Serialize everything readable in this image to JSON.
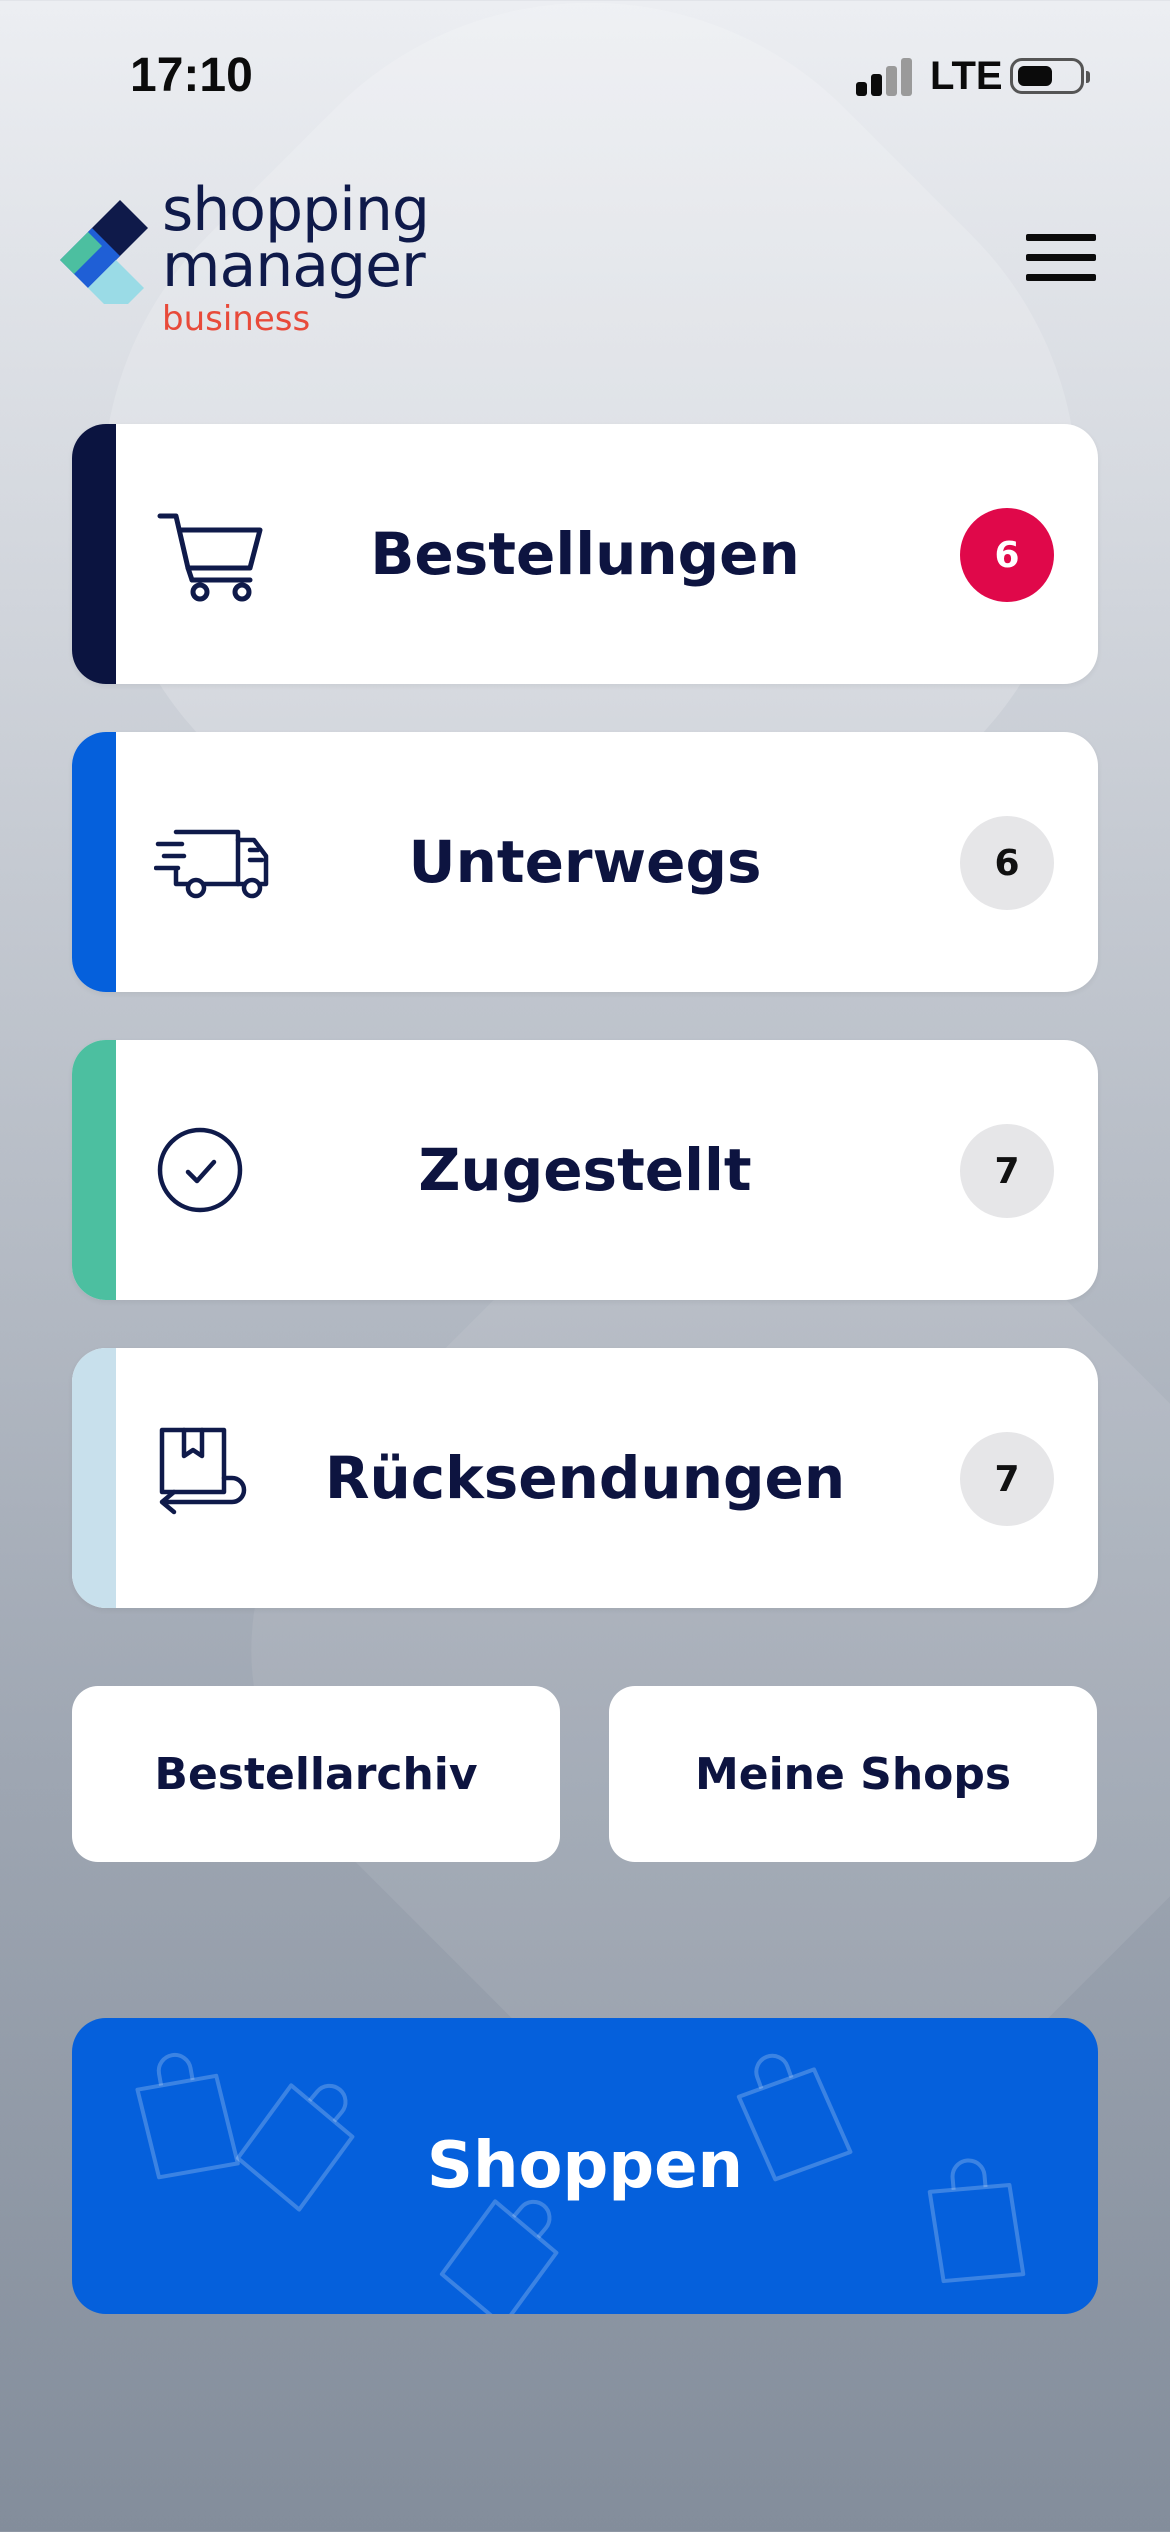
{
  "status_bar": {
    "time": "17:10",
    "network": "LTE",
    "signal_bars_active": 2,
    "signal_bars_total": 4
  },
  "header": {
    "logo_line1": "shopping",
    "logo_line2": "manager",
    "logo_sub": "business",
    "menu_icon": "hamburger-menu-icon"
  },
  "colors": {
    "navy": "#0d1440",
    "brand_blue": "#0560dc",
    "teal": "#4cbfa0",
    "light_blue": "#c8e0ec",
    "badge_red": "#e0084a",
    "logo_red": "#e84a3a"
  },
  "cards": [
    {
      "label": "Bestellungen",
      "count": "6",
      "icon": "shopping-cart-icon",
      "accent": "#0b1440",
      "badge_style": "hot"
    },
    {
      "label": "Unterwegs",
      "count": "6",
      "icon": "delivery-truck-icon",
      "accent": "#0560dc",
      "badge_style": "grey"
    },
    {
      "label": "Zugestellt",
      "count": "7",
      "icon": "check-circle-icon",
      "accent": "#4cbfa0",
      "badge_style": "grey"
    },
    {
      "label": "Rücksendungen",
      "count": "7",
      "icon": "return-box-icon",
      "accent": "#c8e0ec",
      "badge_style": "grey"
    }
  ],
  "actions": {
    "archive_label": "Bestellarchiv",
    "shops_label": "Meine Shops"
  },
  "shop_button": {
    "label": "Shoppen",
    "decoration_icon": "shopping-bag-icon"
  }
}
